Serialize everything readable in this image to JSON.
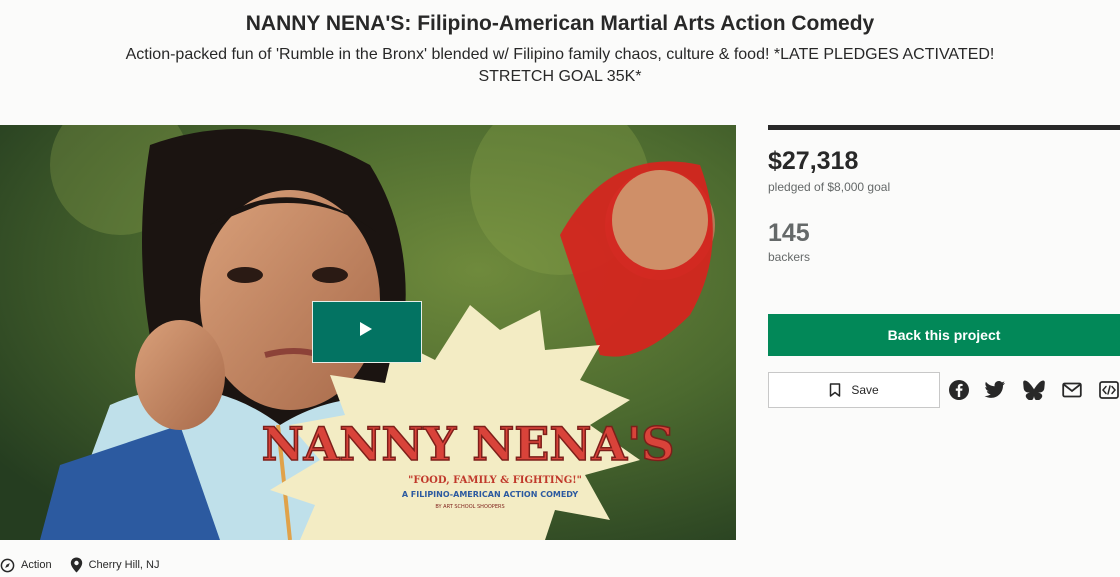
{
  "project": {
    "title": "NANNY NENA'S: Filipino-American Martial Arts Action Comedy",
    "blurb": "Action-packed fun of 'Rumble in the Bronx' blended w/ Filipino family chaos, culture & food! *LATE PLEDGES ACTIVATED! STRETCH GOAL 35K*"
  },
  "video": {
    "poster_logo": "NANNY NENA'S",
    "poster_tagline": "\"FOOD, FAMILY & FIGHTING!\"",
    "poster_subtitle": "A FILIPINO-AMERICAN ACTION COMEDY",
    "poster_credit": "BY ART SCHOOL SHOOPERS",
    "play_icon": "play-icon"
  },
  "stats": {
    "pledged": "$27,318",
    "pledged_label": "pledged of $8,000 goal",
    "backers": "145",
    "backers_label": "backers"
  },
  "actions": {
    "back_label": "Back this project",
    "save_label": "Save",
    "share_icons": [
      "facebook-icon",
      "twitter-icon",
      "bluesky-icon",
      "email-icon",
      "embed-icon"
    ]
  },
  "meta": {
    "category": "Action",
    "location": "Cherry Hill, NJ"
  },
  "colors": {
    "primary_green": "#028858",
    "play_green": "#037362",
    "text_dark": "#282828",
    "text_muted": "#656969"
  }
}
